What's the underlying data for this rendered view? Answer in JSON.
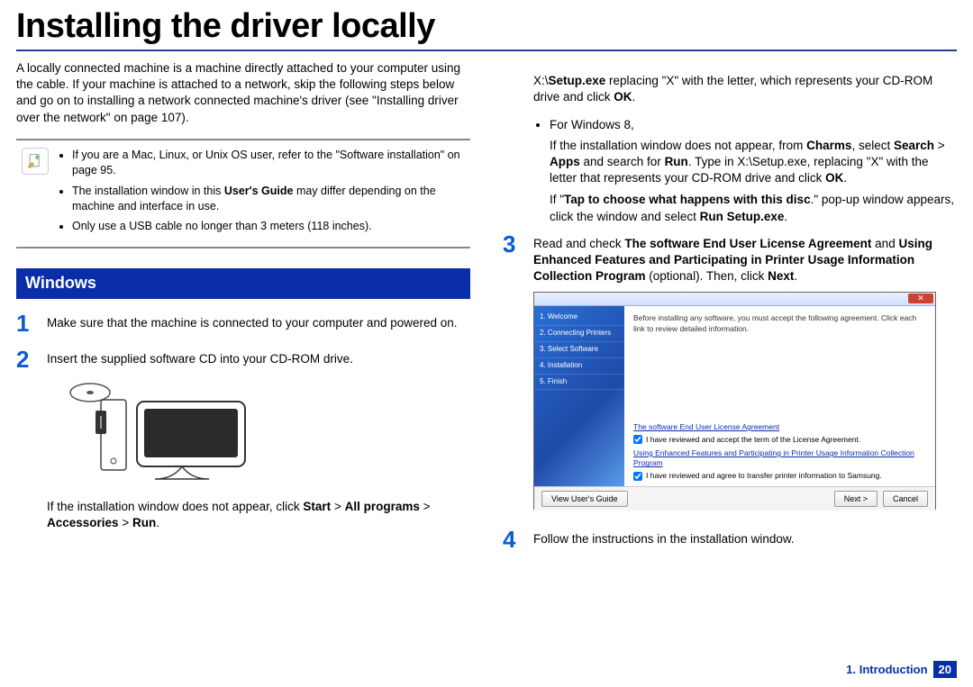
{
  "title": "Installing the driver locally",
  "intro": "A locally connected machine is a machine directly attached to your computer using the cable. If your machine is attached to a network, skip the following steps below and go on to installing a network connected machine's driver (see \"Installing driver over the network\" on page 107).",
  "notes": [
    {
      "pre": "If you are a Mac, Linux, or Unix OS user, refer to the \"Software installation\" on page 95."
    },
    {
      "pre": "The installation window in this ",
      "bold1": "User's Guide",
      "post": " may differ depending on the machine and interface in use."
    },
    {
      "pre": "Only use a USB cable no longer than 3 meters (118 inches)."
    }
  ],
  "section_heading": "Windows",
  "steps_left": {
    "s1": {
      "num": "1",
      "text": "Make sure that the machine is connected to your computer and powered on."
    },
    "s2": {
      "num": "2",
      "text": "Insert the supplied software CD into your CD-ROM drive.",
      "after_pre": "If the installation window does not appear, click ",
      "after_b1": "Start",
      "after_m1": " > ",
      "after_b2": "All programs",
      "after_m2": " > ",
      "after_b3": "Accessories",
      "after_m3": " > ",
      "after_b4": "Run",
      "after_end": "."
    }
  },
  "right_top": {
    "line1_pre": "X:\\",
    "line1_b": "Setup.exe",
    "line1_post": " replacing \"X\" with the letter, which represents your CD-ROM drive and click ",
    "line1_ok": "OK",
    "line1_end": ".",
    "bullet_label": "For Windows 8,",
    "p2_a": "If the installation window does not appear, from ",
    "p2_charms": "Charms",
    "p2_b": ", select ",
    "p2_search": "Search",
    "p2_c": " > ",
    "p2_apps": "Apps",
    "p2_d": " and search for ",
    "p2_run": "Run",
    "p2_e": ". Type in X:\\Setup.exe, replacing \"X\" with the letter that represents your CD-ROM drive and click ",
    "p2_ok": "OK",
    "p2_end": ".",
    "p3_a": "If \"",
    "p3_b": "Tap to choose what happens with this disc",
    "p3_c": ".\" pop-up window appears, click the window and select ",
    "p3_d": "Run Setup.exe",
    "p3_e": "."
  },
  "steps_right": {
    "s3": {
      "num": "3",
      "a": "Read and check ",
      "b1": "The software End User License Agreement",
      "m1": " and ",
      "b2": "Using Enhanced Features and Participating in Printer Usage Information Collection Program",
      "m2": " (optional). Then, click ",
      "b3": "Next",
      "end": "."
    },
    "s4": {
      "num": "4",
      "text": "Follow the instructions in the installation window."
    }
  },
  "installer": {
    "side": [
      "1. Welcome",
      "2. Connecting Printers",
      "3. Select Software",
      "4. Installation",
      "5. Finish"
    ],
    "intro": "Before installing any software, you must accept the following agreement. Click each link to review detailed information.",
    "link1": "The software End User License Agreement",
    "check1": "I have reviewed and accept the term of the License Agreement.",
    "link2": "Using Enhanced Features and Participating in Printer Usage Information Collection Program",
    "check2": "I have reviewed and agree to transfer printer information to Samsung.",
    "btn_guide": "View User's Guide",
    "btn_next": "Next >",
    "btn_cancel": "Cancel"
  },
  "footer": {
    "chapter": "1. Introduction",
    "page": "20"
  }
}
